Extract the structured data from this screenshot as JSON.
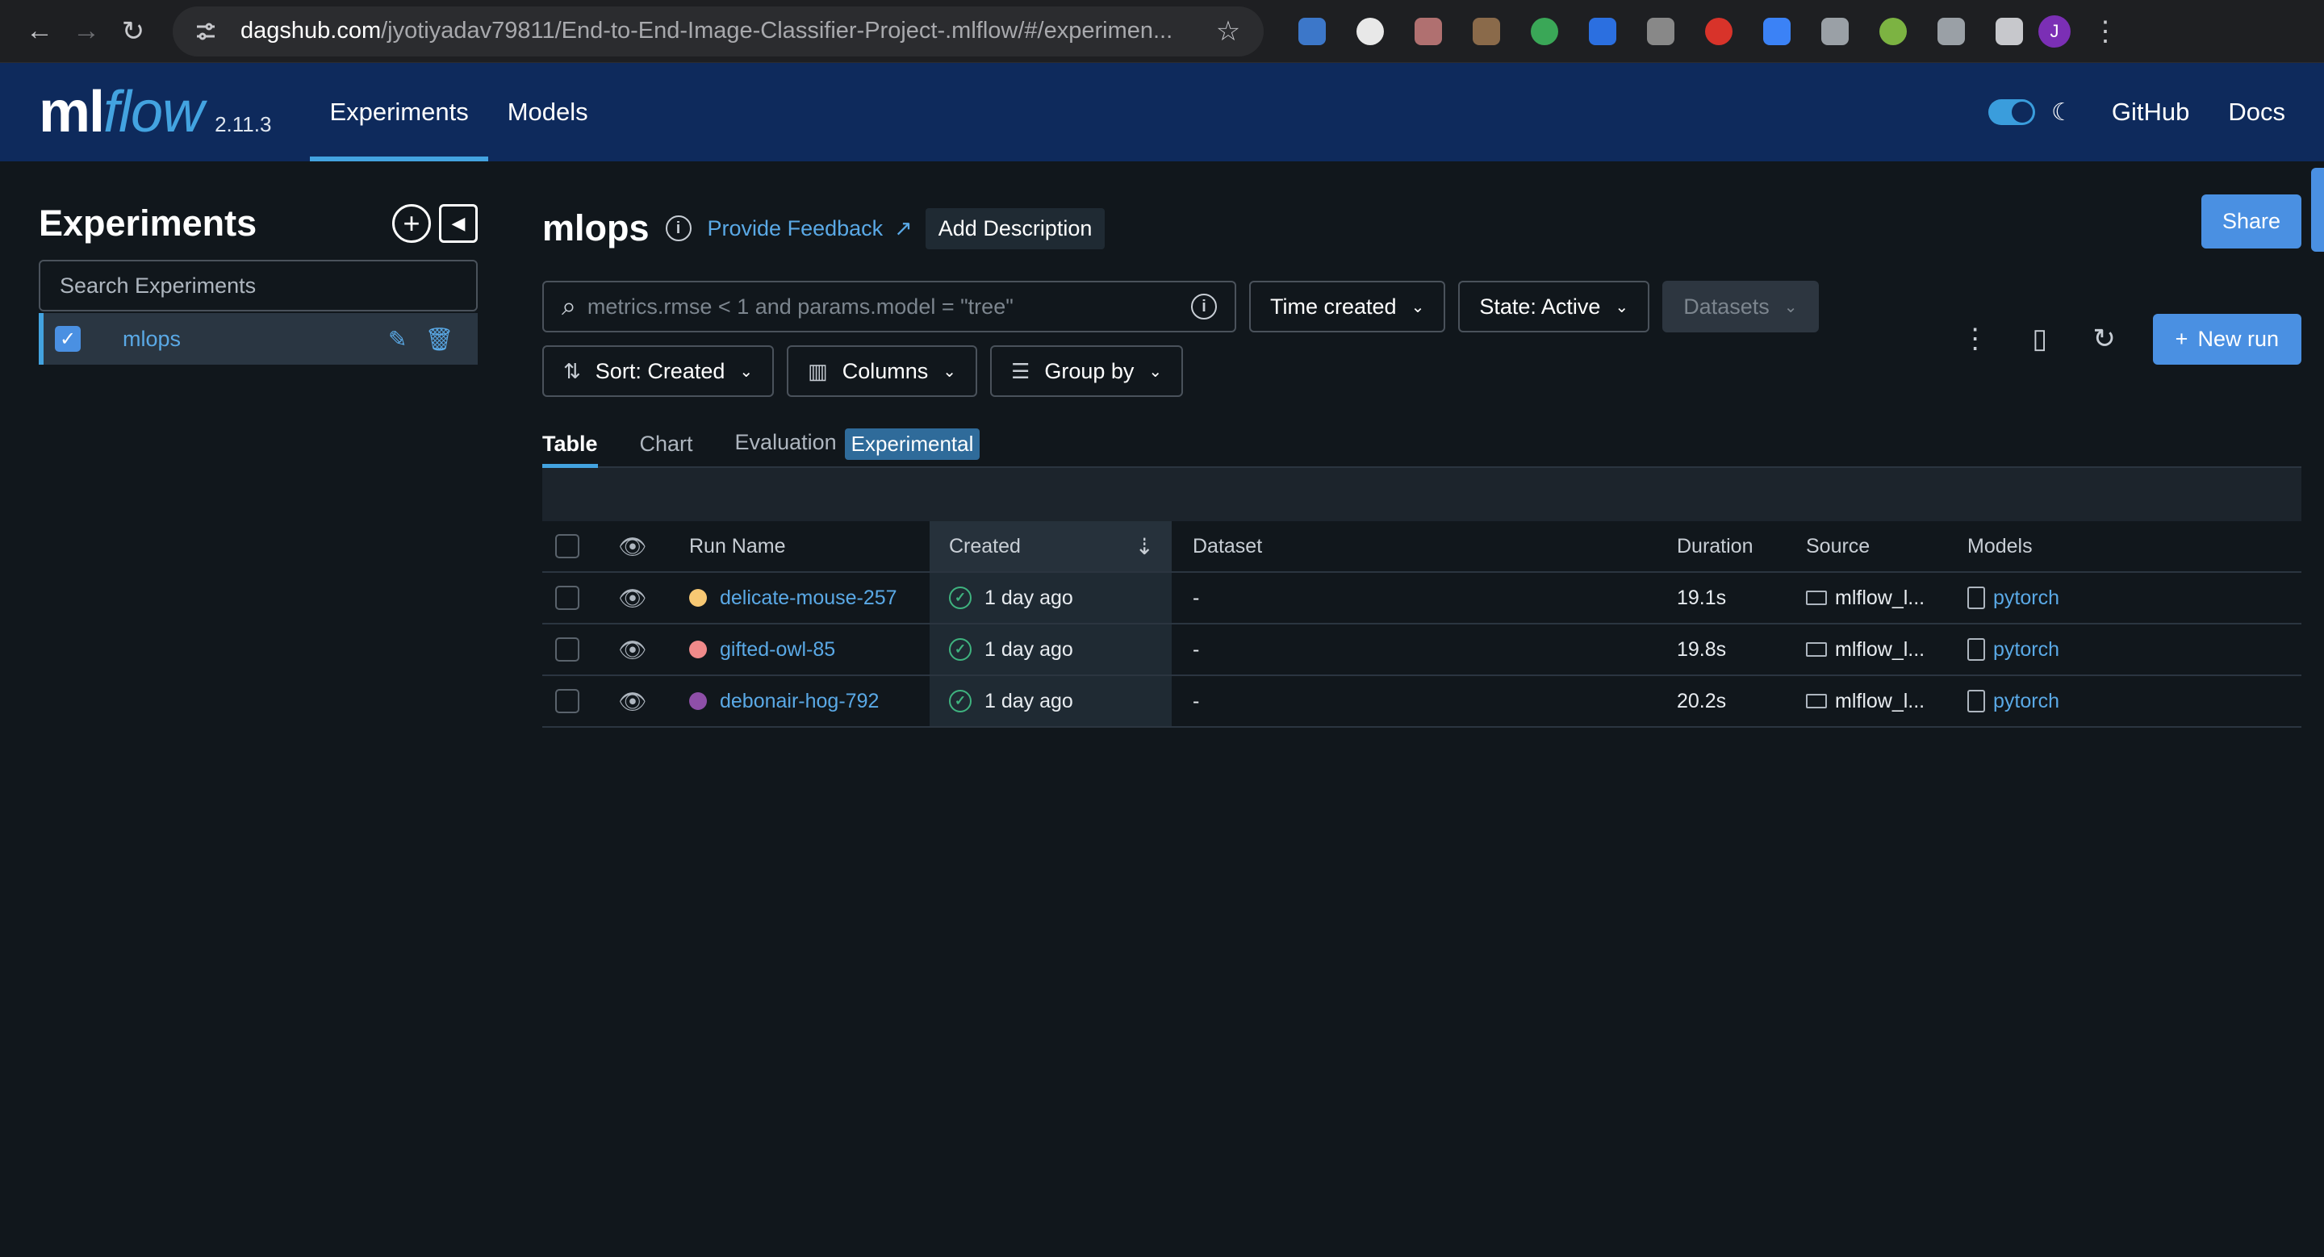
{
  "browser": {
    "url_host": "dagshub.com",
    "url_path": "/jyotiyadav79811/End-to-End-Image-Classifier-Project-.mlflow/#/experimen...",
    "profile_initial": "J",
    "extension_colors": [
      "#3c77c9",
      "#e8e8e8",
      "#b07070",
      "#8a6a4a",
      "#3aa757",
      "#2b6fe0",
      "#888888",
      "#d8332a",
      "#3b82f6",
      "#9aa0a6",
      "#7cb342",
      "#9aa0a6",
      "#c7c8cc"
    ]
  },
  "header": {
    "logo_ml": "ml",
    "logo_flow": "flow",
    "version": "2.11.3",
    "nav": [
      {
        "label": "Experiments",
        "active": true
      },
      {
        "label": "Models",
        "active": false
      }
    ],
    "github": "GitHub",
    "docs": "Docs"
  },
  "sidebar": {
    "title": "Experiments",
    "search_placeholder": "Search Experiments",
    "experiments": [
      {
        "name": "mlops",
        "checked": true
      }
    ]
  },
  "main": {
    "title": "mlops",
    "feedback": "Provide Feedback",
    "add_description": "Add Description",
    "share": "Share",
    "search_placeholder": "metrics.rmse < 1 and params.model = \"tree\"",
    "time_filter": "Time created",
    "state_filter": "State: Active",
    "datasets_filter": "Datasets",
    "sort": "Sort: Created",
    "columns": "Columns",
    "group_by": "Group by",
    "new_run": "New run",
    "tabs": {
      "table": "Table",
      "chart": "Chart",
      "evaluation": "Evaluation",
      "experimental": "Experimental"
    }
  },
  "table": {
    "headers": {
      "run_name": "Run Name",
      "created": "Created",
      "dataset": "Dataset",
      "duration": "Duration",
      "source": "Source",
      "models": "Models"
    },
    "rows": [
      {
        "name": "delicate-mouse-257",
        "color": "#f7c873",
        "created": "1 day ago",
        "dataset": "-",
        "duration": "19.1s",
        "source": "mlflow_l...",
        "model": "pytorch"
      },
      {
        "name": "gifted-owl-85",
        "color": "#f08a8a",
        "created": "1 day ago",
        "dataset": "-",
        "duration": "19.8s",
        "source": "mlflow_l...",
        "model": "pytorch"
      },
      {
        "name": "debonair-hog-792",
        "color": "#8e4fa8",
        "created": "1 day ago",
        "dataset": "-",
        "duration": "20.2s",
        "source": "mlflow_l...",
        "model": "pytorch"
      }
    ]
  }
}
